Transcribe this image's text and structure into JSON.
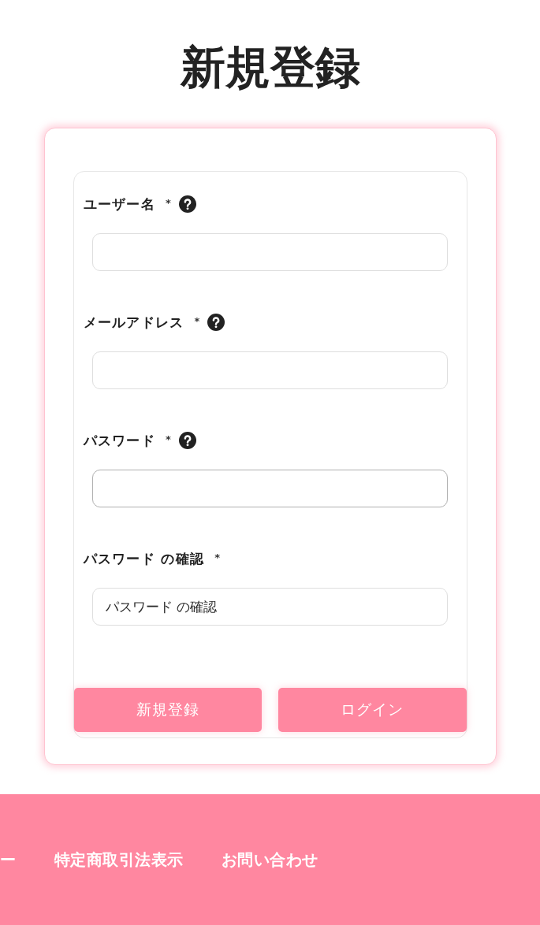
{
  "title": "新規登録",
  "form": {
    "fields": [
      {
        "label": "ユーザー名",
        "required_mark": "*",
        "help": true,
        "focused": false
      },
      {
        "label": "メールアドレス",
        "required_mark": "*",
        "help": true,
        "focused": false
      },
      {
        "label": "パスワード",
        "required_mark": "*",
        "help": true,
        "focused": true
      },
      {
        "label": "パスワード の確認",
        "required_mark": "*",
        "help": false,
        "focused": false,
        "placeholder": "パスワード の確認"
      }
    ],
    "buttons": [
      "新規登録",
      "ログイン"
    ]
  },
  "footer": {
    "links": [
      "ー",
      "特定商取引法表示",
      "お問い合わせ"
    ]
  }
}
